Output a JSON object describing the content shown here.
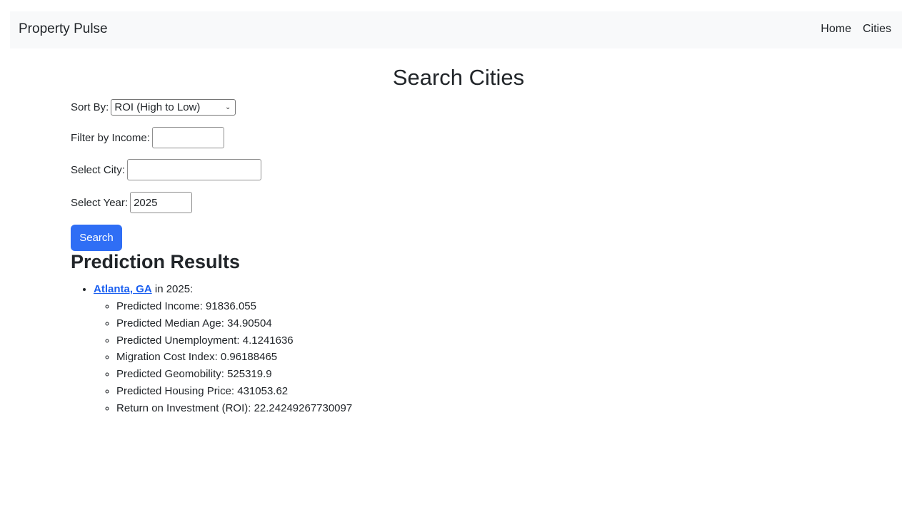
{
  "navbar": {
    "brand": "Property Pulse",
    "links": [
      "Home",
      "Cities"
    ]
  },
  "page_title": "Search Cities",
  "form": {
    "sort_label": "Sort By:",
    "sort_value": "ROI (High to Low)",
    "income_label": "Filter by Income:",
    "income_value": "",
    "city_label": "Select City:",
    "city_value": "",
    "year_label": "Select Year:",
    "year_value": "2025",
    "search_button": "Search"
  },
  "results": {
    "heading": "Prediction Results",
    "items": [
      {
        "city": "Atlanta, GA",
        "year_text": " in 2025:",
        "details": [
          "Predicted Income: 91836.055",
          "Predicted Median Age: 34.90504",
          "Predicted Unemployment: 4.1241636",
          "Migration Cost Index: 0.96188465",
          "Predicted Geomobility: 525319.9",
          "Predicted Housing Price: 431053.62",
          "Return on Investment (ROI): 22.24249267730097"
        ]
      }
    ]
  },
  "colors": {
    "navbar_bg": "#f8f9fa",
    "primary_button": "#2f6ef5",
    "link": "#1a5ff0"
  }
}
